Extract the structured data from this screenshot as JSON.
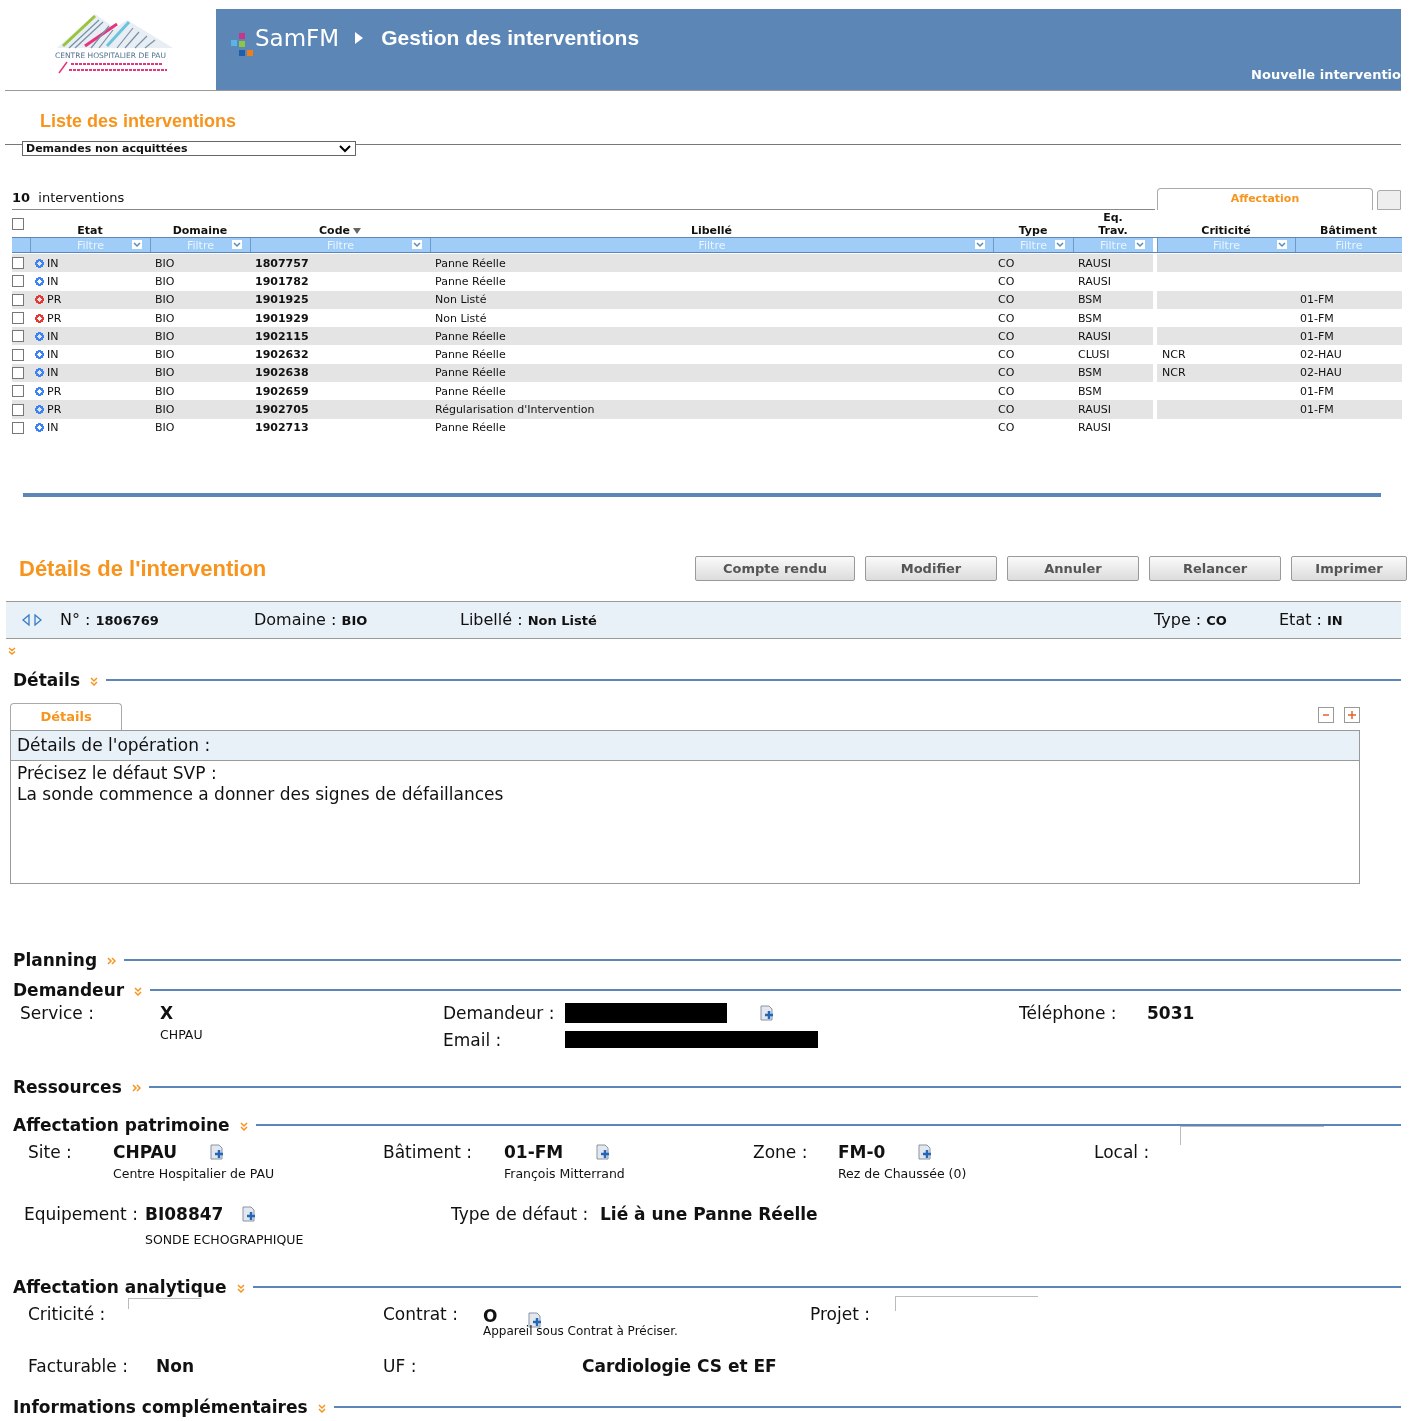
{
  "header": {
    "logo_text": "CENTRE HOSPITALIER DE PAU",
    "app_name": "SamFM",
    "title": "Gestion des interventions",
    "new_link": "Nouvelle interventio"
  },
  "list": {
    "title": "Liste des interventions",
    "view_select": "Demandes non acquittées",
    "count": "10",
    "count_label": "interventions",
    "select_all_checked": false,
    "tabs": [
      {
        "label": "Affectation",
        "selected": true
      }
    ],
    "columns": [
      {
        "label": "Etat",
        "sorted": false,
        "filter": "Filtre",
        "dropdown": true
      },
      {
        "label": "Domaine",
        "sorted": false,
        "filter": "Filtre",
        "dropdown": true
      },
      {
        "label": "Code",
        "sorted": true,
        "filter": "Filtre",
        "dropdown": true
      },
      {
        "label": "Libellé",
        "sorted": false,
        "filter": "Filtre",
        "dropdown": true
      },
      {
        "label": "Type",
        "sorted": false,
        "filter": "Filtre",
        "dropdown": true
      },
      {
        "label": "Eq.\nTrav.",
        "sorted": false,
        "filter": "Filtre",
        "dropdown": true
      },
      {
        "label": "Criticité",
        "sorted": false,
        "filter": "Filtre",
        "dropdown": true
      },
      {
        "label": "Bâtiment",
        "sorted": false,
        "filter": "Filtre",
        "dropdown": false
      }
    ],
    "rows": [
      {
        "checked": false,
        "color": "#3b82f6",
        "cells": [
          "IN",
          "BIO",
          "1807757",
          "Panne Réelle",
          "CO",
          "RAUSI",
          "",
          ""
        ]
      },
      {
        "checked": false,
        "color": "#3b82f6",
        "cells": [
          "IN",
          "BIO",
          "1901782",
          "Panne Réelle",
          "CO",
          "RAUSI",
          "",
          ""
        ]
      },
      {
        "checked": false,
        "color": "#e53935",
        "cells": [
          "PR",
          "BIO",
          "1901925",
          "Non Listé",
          "CO",
          "BSM",
          "",
          "01-FM"
        ]
      },
      {
        "checked": false,
        "color": "#e53935",
        "cells": [
          "PR",
          "BIO",
          "1901929",
          "Non Listé",
          "CO",
          "BSM",
          "",
          "01-FM"
        ]
      },
      {
        "checked": false,
        "color": "#3b82f6",
        "cells": [
          "IN",
          "BIO",
          "1902115",
          "Panne Réelle",
          "CO",
          "RAUSI",
          "",
          "01-FM"
        ]
      },
      {
        "checked": false,
        "color": "#3b82f6",
        "cells": [
          "IN",
          "BIO",
          "1902632",
          "Panne Réelle",
          "CO",
          "CLUSI",
          "NCR",
          "02-HAU"
        ]
      },
      {
        "checked": false,
        "color": "#3b82f6",
        "cells": [
          "IN",
          "BIO",
          "1902638",
          "Panne Réelle",
          "CO",
          "BSM",
          "NCR",
          "02-HAU"
        ]
      },
      {
        "checked": false,
        "color": "#3b82f6",
        "cells": [
          "PR",
          "BIO",
          "1902659",
          "Panne Réelle",
          "CO",
          "BSM",
          "",
          "01-FM"
        ]
      },
      {
        "checked": false,
        "color": "#3b82f6",
        "cells": [
          "PR",
          "BIO",
          "1902705",
          "Régularisation d'Intervention",
          "CO",
          "RAUSI",
          "",
          "01-FM"
        ]
      },
      {
        "checked": false,
        "color": "#3b82f6",
        "cells": [
          "IN",
          "BIO",
          "1902713",
          "Panne Réelle",
          "CO",
          "RAUSI",
          "",
          ""
        ]
      }
    ]
  },
  "details": {
    "title": "Détails de l'intervention",
    "buttons": [
      "Compte rendu",
      "Modifier",
      "Annuler",
      "Relancer",
      "Imprimer"
    ],
    "summary": [
      {
        "label": "N° :",
        "value": "1806769"
      },
      {
        "label": "Domaine :",
        "value": "BIO"
      },
      {
        "label": "Libellé :",
        "value": "Non Listé"
      },
      {
        "label": "Type :",
        "value": "CO"
      },
      {
        "label": "Etat :",
        "value": "IN"
      }
    ],
    "details_section": {
      "title": "Détails",
      "expanded": true,
      "tab": "Détails",
      "box_title": "Détails de l'opération :",
      "body_lines": [
        "Précisez le défaut SVP :",
        "La sonde commence a donner des signes de défaillances"
      ]
    },
    "planning": {
      "title": "Planning",
      "expanded": false
    },
    "demandeur": {
      "title": "Demandeur",
      "expanded": true,
      "service_label": "Service :",
      "service": "X",
      "service_sub": "CHPAU",
      "demandeur_label": "Demandeur :",
      "email_label": "Email :",
      "phone_label": "Téléphone :",
      "phone": "5031"
    },
    "ressources": {
      "title": "Ressources",
      "expanded": false
    },
    "patrimoine": {
      "title": "Affectation patrimoine",
      "expanded": true,
      "site_label": "Site :",
      "site": "CHPAU",
      "site_sub": "Centre Hospitalier de PAU",
      "batiment_label": "Bâtiment :",
      "batiment": "01-FM",
      "batiment_sub": "François Mitterrand",
      "zone_label": "Zone :",
      "zone": "FM-0",
      "zone_sub": "Rez de Chaussée (0)",
      "local_label": "Local :",
      "equipement_label": "Equipement :",
      "equipement": "BI08847",
      "equipement_sub": "SONDE ECHOGRAPHIQUE",
      "defaut_label": "Type de défaut :",
      "defaut": "Lié à une Panne Réelle"
    },
    "analytique": {
      "title": "Affectation analytique",
      "expanded": true,
      "criticite_label": "Criticité :",
      "contrat_label": "Contrat :",
      "contrat": "O",
      "contrat_sub": "Appareil sous Contrat à Préciser.",
      "projet_label": "Projet :",
      "facturable_label": "Facturable :",
      "facturable": "Non",
      "uf_label": "UF :",
      "uf": "Cardiologie CS et EF"
    },
    "infos": {
      "title": "Informations complémentaires",
      "expanded": true
    }
  }
}
